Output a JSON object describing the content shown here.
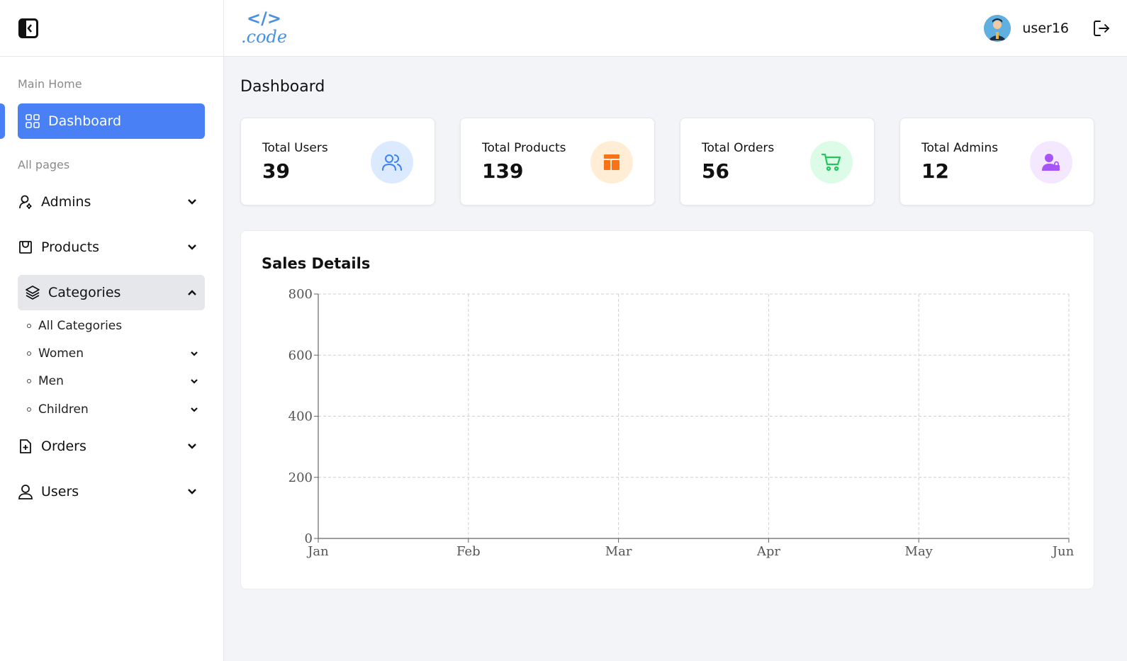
{
  "sidebar": {
    "collapse_icon": "collapse-left-icon",
    "main_section_label": "Main Home",
    "dashboard_label": "Dashboard",
    "pages_section_label": "All pages",
    "items": [
      {
        "label": "Admins",
        "icon": "admin-user-icon"
      },
      {
        "label": "Products",
        "icon": "bag-icon"
      },
      {
        "label": "Categories",
        "icon": "layers-icon"
      },
      {
        "label": "Orders",
        "icon": "file-plus-icon"
      },
      {
        "label": "Users",
        "icon": "user-icon"
      }
    ],
    "categories_sub": [
      {
        "label": "All Categories"
      },
      {
        "label": "Women"
      },
      {
        "label": "Men"
      },
      {
        "label": "Children"
      }
    ],
    "accent_color": "#4a80f5"
  },
  "header": {
    "logo_text": ".code",
    "username": "user16"
  },
  "main": {
    "page_title": "Dashboard",
    "stats": [
      {
        "label": "Total Users",
        "value": "39",
        "icon": "users-icon",
        "color": "#3b82f6",
        "bg": "#dbeafe"
      },
      {
        "label": "Total Products",
        "value": "139",
        "icon": "product-icon",
        "color": "#f97316",
        "bg": "#ffedd5"
      },
      {
        "label": "Total Orders",
        "value": "56",
        "icon": "cart-icon",
        "color": "#22c55e",
        "bg": "#dcfce7"
      },
      {
        "label": "Total Admins",
        "value": "12",
        "icon": "admin-lock-icon",
        "color": "#a855f7",
        "bg": "#f3e8ff"
      }
    ],
    "chart_title": "Sales Details"
  },
  "chart_data": {
    "type": "line",
    "title": "Sales Details",
    "categories": [
      "Jan",
      "Feb",
      "Mar",
      "Apr",
      "May",
      "Jun"
    ],
    "series": [],
    "xlabel": "",
    "ylabel": "",
    "ylim": [
      0,
      800
    ],
    "yticks": [
      "0",
      "200",
      "400",
      "600",
      "800"
    ],
    "grid": true
  }
}
